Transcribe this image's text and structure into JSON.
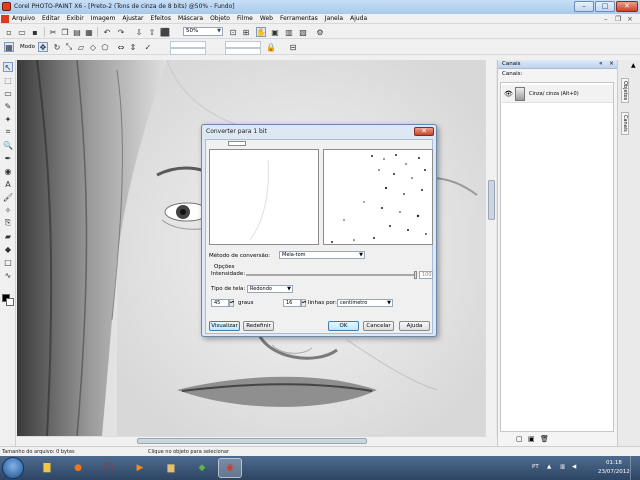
{
  "window": {
    "title": "Corel PHOTO-PAINT X6 - [Preto-2 (Tons de cinza de 8 bits) @50% - Fundo]",
    "minimize": "–",
    "maximize": "□",
    "close": "✕"
  },
  "menu": {
    "items": [
      "Arquivo",
      "Editar",
      "Exibir",
      "Imagem",
      "Ajustar",
      "Efeitos",
      "Máscara",
      "Objeto",
      "Filme",
      "Web",
      "Ferramentas",
      "Janela",
      "Ajuda"
    ]
  },
  "toolbar": {
    "zoom": "50%"
  },
  "propertybar": {
    "mode_label": "Modo"
  },
  "dialog": {
    "title": "Converter para 1 bit",
    "close": "✕",
    "method_label": "Método de conversão:",
    "method_value": "Meia-tom",
    "options_label": "Opções",
    "intensity_label": "Intensidade:",
    "intensity_value": "100",
    "screen_type_label": "Tipo de tela:",
    "screen_type_value": "Redondo",
    "angle_value": "45",
    "angle_unit": "graus",
    "lines_value": "16",
    "lines_label": "linhas por:",
    "unit_value": "centímetro",
    "preview_button": "Visualizar",
    "reset_button": "Redefinir",
    "ok_button": "OK",
    "cancel_button": "Cancelar",
    "help_button": "Ajuda"
  },
  "docker": {
    "title": "Canais",
    "sub_label": "Canais:",
    "channel_name": "Cinza/ cinza  (Alt+0)",
    "side_tabs": [
      "Objetos",
      "Canais"
    ]
  },
  "status": {
    "file_size": "Tamanho do arquivo: 0 bytes",
    "hint": "Clique no objeto para selecionar"
  },
  "taskbar": {
    "lang": "PT",
    "time": "01:18",
    "date": "23/07/2012"
  },
  "colors": {
    "title_bar": "#b9d3f0",
    "dialog_frame": "#dde8f4",
    "taskbar": "#3b5677"
  }
}
